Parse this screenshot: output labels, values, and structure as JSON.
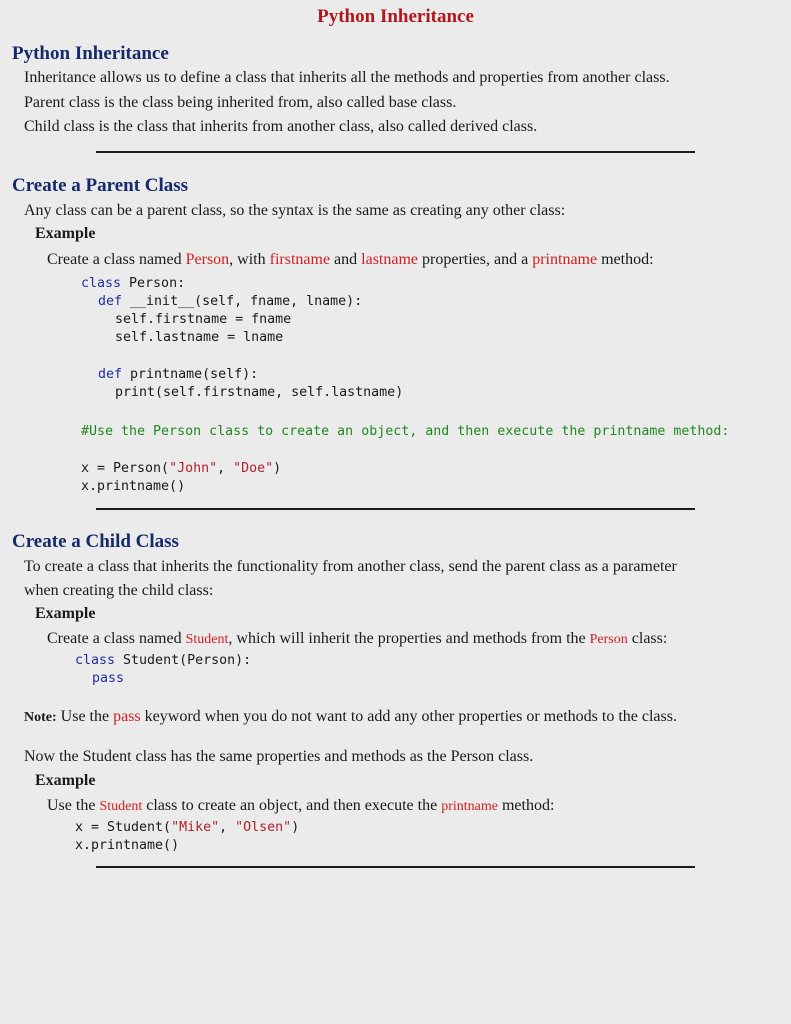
{
  "page_title": "Python Inheritance",
  "colors": {
    "page_title": "#b0161c",
    "section_heading": "#142a6b",
    "highlight": "#d21e1e",
    "code_keyword": "#1f2ea3",
    "code_string": "#b0222a",
    "code_comment": "#1f8a1f",
    "background": "#ebebeb"
  },
  "intro": {
    "heading": "Python Inheritance",
    "lines": [
      "Inheritance allows us to define a class that inherits all the methods and properties from another class.",
      "Parent class is the class being inherited from, also called base class.",
      "Child class is the class that inherits from another class, also called derived class."
    ]
  },
  "parent": {
    "heading": "Create a Parent Class",
    "description": "Any class can be a parent class, so the syntax is the same as creating any other class:",
    "example_label": "Example",
    "example_text": {
      "t1": "Create a class named ",
      "h1": "Person",
      "t2": ", with ",
      "h2": "firstname",
      "t3": " and ",
      "h3": "lastname",
      "t4": " properties, and a ",
      "h4": "printname",
      "t5": " method:"
    },
    "code": {
      "l1_kw": "class",
      "l1_rest": " Person:",
      "l2_kw": "def",
      "l2_rest": " __init__(self, fname, lname):",
      "l3": "self.firstname = fname",
      "l4": "self.lastname = lname",
      "l5_kw": "def",
      "l5_rest": " printname(self):",
      "l6": "print(self.firstname, self.lastname)",
      "comment": "#Use the Person class to create an object, and then execute the printname method:",
      "l7_a": "x = Person(",
      "l7_s1": "\"John\"",
      "l7_b": ", ",
      "l7_s2": "\"Doe\"",
      "l7_c": ")",
      "l8": "x.printname()"
    }
  },
  "child": {
    "heading": "Create a Child Class",
    "description_l1": "To create a class that inherits the functionality from another class, send the parent class as a parameter",
    "description_l2": "when creating the child class:",
    "example_label": "Example",
    "example_text": {
      "t1": "Create a class named ",
      "h1": "Student",
      "t2": ", which will inherit the properties and methods from the ",
      "h2": "Person",
      "t3": " class:"
    },
    "code": {
      "l1_kw": "class",
      "l1_rest": " Student(Person):",
      "l2_kw": "pass"
    },
    "note": {
      "label": "Note:",
      "t1": " Use the ",
      "h1": "pass",
      "t2": " keyword when you do not want to add any other properties or methods to the class."
    },
    "now_text": "Now the Student class has the same properties and methods as the Person class.",
    "example2_label": "Example",
    "example2_text": {
      "t1": "Use the ",
      "h1": "Student",
      "t2": " class to create an object, and then execute the ",
      "h2": "printname",
      "t3": " method:"
    },
    "code2": {
      "l1_a": "x = Student(",
      "l1_s1": "\"Mike\"",
      "l1_b": ", ",
      "l1_s2": "\"Olsen\"",
      "l1_c": ")",
      "l2": "x.printname()"
    }
  }
}
